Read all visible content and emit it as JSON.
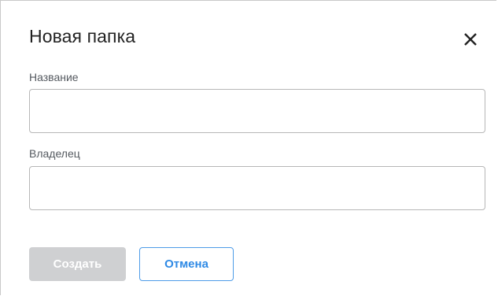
{
  "dialog": {
    "title": "Новая папка",
    "close_icon": "close-icon",
    "fields": {
      "name": {
        "label": "Название",
        "value": "",
        "placeholder": ""
      },
      "owner": {
        "label": "Владелец",
        "value": "",
        "placeholder": ""
      }
    },
    "buttons": {
      "create_label": "Создать",
      "create_disabled": true,
      "cancel_label": "Отмена"
    }
  },
  "colors": {
    "title_text": "#222222",
    "label_text": "#555a60",
    "input_border": "#b7b7b7",
    "disabled_button_bg": "#cfd0d2",
    "accent": "#2f8ae5"
  }
}
